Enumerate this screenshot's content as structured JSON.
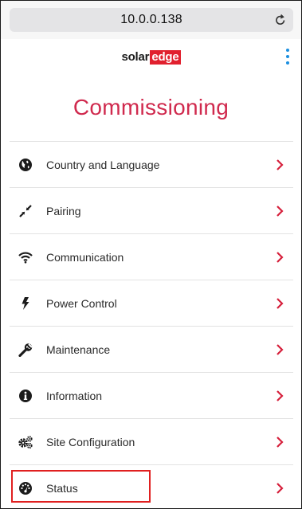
{
  "browser": {
    "url": "10.0.0.138",
    "reload_icon": "reload-icon"
  },
  "header": {
    "logo_part1": "solar",
    "logo_part2": "edge",
    "menu_icon": "kebab-menu-icon"
  },
  "page": {
    "title": "Commissioning"
  },
  "menu": {
    "items": [
      {
        "label": "Country and Language",
        "icon": "globe-icon"
      },
      {
        "label": "Pairing",
        "icon": "pairing-arrows-icon"
      },
      {
        "label": "Communication",
        "icon": "wifi-icon"
      },
      {
        "label": "Power Control",
        "icon": "lightning-bolt-icon"
      },
      {
        "label": "Maintenance",
        "icon": "wrench-icon"
      },
      {
        "label": "Information",
        "icon": "info-icon"
      },
      {
        "label": "Site Configuration",
        "icon": "gears-icon"
      },
      {
        "label": "Status",
        "icon": "dashboard-gauge-icon"
      }
    ]
  },
  "colors": {
    "accent": "#d02a4e",
    "chevron": "#d6203c",
    "logo_red": "#e1202e",
    "kebab_blue": "#1b8fe0",
    "highlight_box": "#e02020"
  }
}
